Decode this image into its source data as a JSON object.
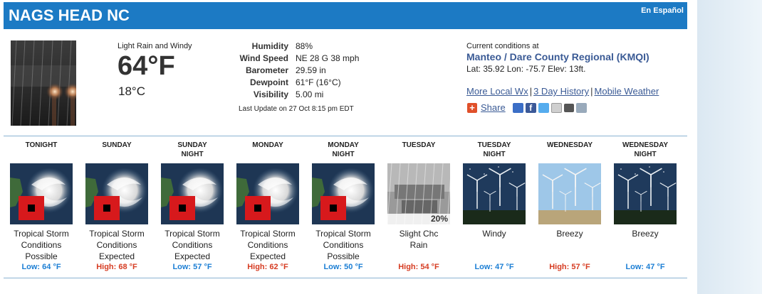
{
  "location": {
    "title": "NAGS HEAD NC",
    "spanish_link": "En Español"
  },
  "current": {
    "condition": "Light Rain and Windy",
    "temp_f": "64°F",
    "temp_c": "18°C",
    "details": [
      {
        "label": "Humidity",
        "value": "88%"
      },
      {
        "label": "Wind Speed",
        "value": "NE 28 G 38 mph"
      },
      {
        "label": "Barometer",
        "value": "29.59 in"
      },
      {
        "label": "Dewpoint",
        "value": "61°F (16°C)"
      },
      {
        "label": "Visibility",
        "value": "5.00 mi"
      }
    ],
    "last_update": "Last Update on 27 Oct 8:15 pm EDT"
  },
  "station": {
    "lead": "Current conditions at",
    "name": "Manteo / Dare County Regional (KMQI)",
    "latlon": "Lat: 35.92 Lon: -75.7 Elev: 13ft."
  },
  "links": {
    "local": "More Local Wx",
    "sep": "|",
    "three_day": "3 Day History",
    "mobile": "Mobile Weather"
  },
  "share": {
    "label": "Share",
    "icons": [
      "delicious-icon",
      "facebook-icon",
      "twitter-icon",
      "email-icon",
      "print-icon",
      "rss-icon"
    ]
  },
  "forecast": [
    {
      "period_l1": "TONIGHT",
      "period_l2": "",
      "image": "hurricane",
      "desc": [
        "Tropical Storm",
        "Conditions",
        "Possible"
      ],
      "temp": "Low: 64 °F",
      "kind": "low"
    },
    {
      "period_l1": "SUNDAY",
      "period_l2": "",
      "image": "hurricane",
      "desc": [
        "Tropical Storm",
        "Conditions",
        "Expected"
      ],
      "temp": "High: 68 °F",
      "kind": "high"
    },
    {
      "period_l1": "SUNDAY",
      "period_l2": "NIGHT",
      "image": "hurricane",
      "desc": [
        "Tropical Storm",
        "Conditions",
        "Expected"
      ],
      "temp": "Low: 57 °F",
      "kind": "low"
    },
    {
      "period_l1": "MONDAY",
      "period_l2": "",
      "image": "hurricane",
      "desc": [
        "Tropical Storm",
        "Conditions",
        "Expected"
      ],
      "temp": "High: 62 °F",
      "kind": "high"
    },
    {
      "period_l1": "MONDAY",
      "period_l2": "NIGHT",
      "image": "hurricane",
      "desc": [
        "Tropical Storm",
        "Conditions",
        "Possible"
      ],
      "temp": "Low: 50 °F",
      "kind": "low"
    },
    {
      "period_l1": "TUESDAY",
      "period_l2": "",
      "image": "rain",
      "pop": "20%",
      "desc": [
        "Slight Chc",
        "Rain",
        ""
      ],
      "temp": "High: 54 °F",
      "kind": "high"
    },
    {
      "period_l1": "TUESDAY",
      "period_l2": "NIGHT",
      "image": "wind-night",
      "desc": [
        "Windy",
        "",
        ""
      ],
      "temp": "Low: 47 °F",
      "kind": "low"
    },
    {
      "period_l1": "WEDNESDAY",
      "period_l2": "",
      "image": "wind-day",
      "desc": [
        "Breezy",
        "",
        ""
      ],
      "temp": "High: 57 °F",
      "kind": "high"
    },
    {
      "period_l1": "WEDNESDAY",
      "period_l2": "NIGHT",
      "image": "wind-night",
      "desc": [
        "Breezy",
        "",
        ""
      ],
      "temp": "Low: 47 °F",
      "kind": "low"
    }
  ],
  "colors": {
    "header": "#1c7ac4",
    "high": "#d63c22",
    "low": "#1b7ed4",
    "link": "#3a5a95"
  }
}
